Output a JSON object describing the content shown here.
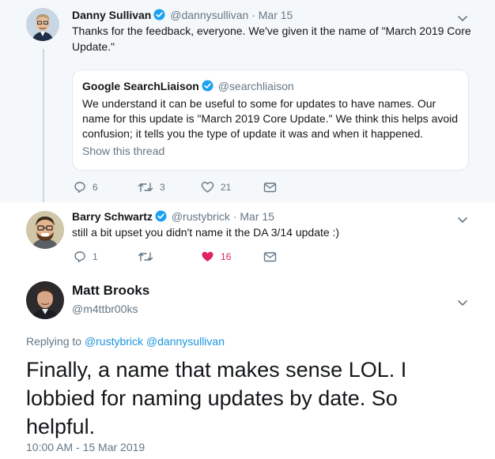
{
  "colors": {
    "accent": "#1da1f2",
    "like_active": "#e0245e",
    "secondary_text": "#657786",
    "thread_bg": "#f5f8fa"
  },
  "tweets": [
    {
      "name": "Danny Sullivan",
      "handle": "@dannysullivan",
      "dot": "·",
      "date": "Mar 15",
      "text": "Thanks for the feedback, everyone. We've given it the name of \"March 2019 Core Update.\"",
      "quote": {
        "name": "Google SearchLiaison",
        "handle": "@searchliaison",
        "text": "We understand it can be useful to some for updates to have names. Our name for this update is \"March 2019 Core Update.\" We think this helps avoid confusion; it tells you the type of update it was and when it happened.",
        "show_thread": "Show this thread"
      },
      "actions": {
        "replies": "6",
        "retweets": "3",
        "likes": "21"
      }
    },
    {
      "name": "Barry Schwartz",
      "handle": "@rustybrick",
      "dot": "·",
      "date": "Mar 15",
      "text": "still a bit upset you didn't name it the DA 3/14 update :)",
      "actions": {
        "replies": "1",
        "retweets": "",
        "likes": "16"
      }
    }
  ],
  "main_tweet": {
    "name": "Matt Brooks",
    "handle": "@m4ttbr00ks",
    "replying_prefix": "Replying to",
    "replying_users": "@rustybrick @dannysullivan",
    "text": "Finally, a name that makes sense LOL. I lobbied for naming updates by date. So helpful.",
    "timestamp": "10:00 AM - 15 Mar 2019"
  }
}
